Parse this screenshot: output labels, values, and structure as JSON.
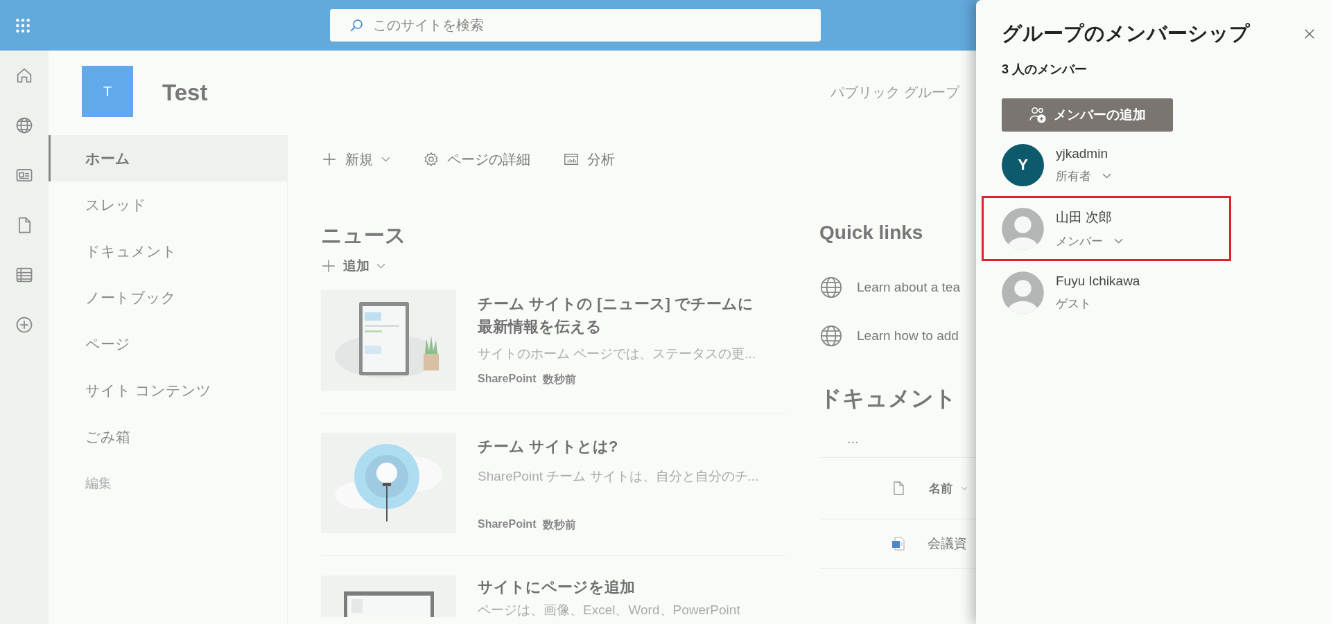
{
  "top_bar": {
    "search": {
      "placeholder": "このサイトを検索"
    }
  },
  "site": {
    "logo_letter": "T",
    "title": "Test",
    "privacy": "パブリック グループ"
  },
  "nav": [
    {
      "label": "ホーム",
      "selected": true,
      "kind": "link"
    },
    {
      "label": "スレッド",
      "selected": false,
      "kind": "link"
    },
    {
      "label": "ドキュメント",
      "selected": false,
      "kind": "link"
    },
    {
      "label": "ノートブック",
      "selected": false,
      "kind": "link"
    },
    {
      "label": "ページ",
      "selected": false,
      "kind": "link"
    },
    {
      "label": "サイト コンテンツ",
      "selected": false,
      "kind": "link"
    },
    {
      "label": "ごみ箱",
      "selected": false,
      "kind": "link"
    },
    {
      "label": "編集",
      "selected": false,
      "kind": "edit"
    }
  ],
  "command_bar": [
    {
      "label": "新規",
      "kind": "new"
    },
    {
      "label": "ページの詳細",
      "kind": "details"
    },
    {
      "label": "分析",
      "kind": "analytics"
    }
  ],
  "news": {
    "title": "ニュース",
    "add": "追加",
    "items": [
      {
        "kind": "tablet",
        "title": "チーム サイトの [ニュース] でチームに最新情報を伝える",
        "description": "サイトのホーム ページでは、ステータスの更...",
        "source": "SharePoint",
        "time": "数秒前"
      },
      {
        "kind": "bulb",
        "title": "チーム サイトとは?",
        "description": "SharePoint チーム サイトは、自分と自分のチ...",
        "source": "SharePoint",
        "time": "数秒前"
      },
      {
        "kind": "monitor",
        "title": "サイトにページを追加",
        "description": "ページは、画像、Excel、Word、PowerPoint"
      }
    ]
  },
  "quick_links": {
    "title": "Quick links",
    "items": [
      "Learn about a tea",
      "Learn how to add"
    ]
  },
  "documents": {
    "title": "ドキュメント",
    "more": "...",
    "column": "名前",
    "rows": [
      {
        "name": "会議資"
      }
    ]
  },
  "panel": {
    "title": "グループのメンバーシップ",
    "count": "3 人のメンバー",
    "add_button": "メンバーの追加",
    "members": [
      {
        "name": "yjkadmin",
        "kind": "initial",
        "initial": "Y",
        "role": "所有者",
        "has_dropdown": true,
        "highlighted": false
      },
      {
        "name": "山田 次郎",
        "kind": "silhouette",
        "role": "メンバー",
        "has_dropdown": true,
        "highlighted": true
      },
      {
        "name": "Fuyu Ichikawa",
        "kind": "silhouette",
        "role": "ゲスト",
        "has_dropdown": false,
        "highlighted": false
      }
    ]
  }
}
